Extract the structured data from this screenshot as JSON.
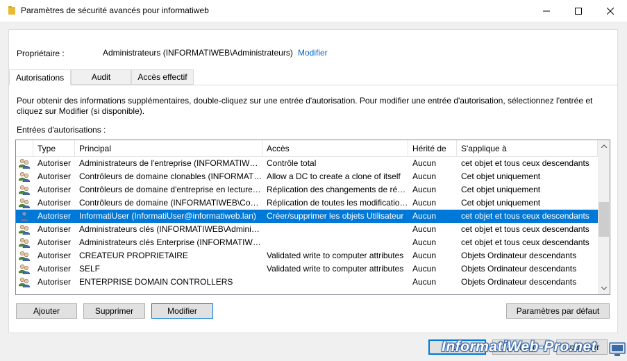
{
  "window": {
    "title": "Paramètres de sécurité avancés pour informatiweb",
    "minimize_glyph": "—",
    "maximize_glyph": "☐",
    "close_glyph": "✕",
    "folder_icon": "folder-icon",
    "folder_color": "#e8b931"
  },
  "owner": {
    "label": "Propriétaire :",
    "value": "Administrateurs (INFORMATIWEB\\Administrateurs)",
    "link": "Modifier",
    "link_color": "#0066cc"
  },
  "tabs": [
    {
      "label": "Autorisations",
      "active": true
    },
    {
      "label": "Audit",
      "active": false
    },
    {
      "label": "Accès effectif",
      "active": false
    }
  ],
  "info_text": "Pour obtenir des informations supplémentaires, double-cliquez sur une entrée d'autorisation. Pour modifier une entrée d'autorisation, sélectionnez l'entrée et cliquez sur Modifier (si disponible).",
  "entries_label": "Entrées d'autorisations :",
  "table": {
    "columns": [
      "Type",
      "Principal",
      "Accès",
      "Hérité de",
      "S'applique à"
    ],
    "rows": [
      {
        "icon": "group-users-icon",
        "type": "Autoriser",
        "principal": "Administrateurs de l'entreprise (INFORMATIWEB\\Administrateurs de l'entreprise)",
        "acces": "Contrôle total",
        "herite": "Aucun",
        "applique": "cet objet et tous ceux descendants",
        "selected": false
      },
      {
        "icon": "group-users-icon",
        "type": "Autoriser",
        "principal": "Contrôleurs de domaine clonables (INFORMATIWEB\\Contrôleurs de domaine clonables)",
        "acces": "Allow a DC to create a clone of itself",
        "herite": "Aucun",
        "applique": "Cet objet uniquement",
        "selected": false
      },
      {
        "icon": "group-users-icon",
        "type": "Autoriser",
        "principal": "Contrôleurs de domaine d'entreprise en lecture seule",
        "acces": "Réplication des changements de répertoire",
        "herite": "Aucun",
        "applique": "Cet objet uniquement",
        "selected": false
      },
      {
        "icon": "group-users-icon",
        "type": "Autoriser",
        "principal": "Contrôleurs de domaine (INFORMATIWEB\\Contrôleurs de domaine)",
        "acces": "Réplication de toutes les modifications",
        "herite": "Aucun",
        "applique": "Cet objet uniquement",
        "selected": false
      },
      {
        "icon": "single-user-icon",
        "type": "Autoriser",
        "principal": "InformatiUser (InformatiUser@informatiweb.lan)",
        "acces": "Créer/supprimer les objets Utilisateur",
        "herite": "Aucun",
        "applique": "cet objet et tous ceux descendants",
        "selected": true
      },
      {
        "icon": "group-users-icon",
        "type": "Autoriser",
        "principal": "Administrateurs clés (INFORMATIWEB\\Administrateurs clés)",
        "acces": "",
        "herite": "Aucun",
        "applique": "cet objet et tous ceux descendants",
        "selected": false
      },
      {
        "icon": "group-users-icon",
        "type": "Autoriser",
        "principal": "Administrateurs clés Enterprise (INFORMATIWEB\\Administrateurs clés Enterprise)",
        "acces": "",
        "herite": "Aucun",
        "applique": "cet objet et tous ceux descendants",
        "selected": false
      },
      {
        "icon": "group-users-icon",
        "type": "Autoriser",
        "principal": "CREATEUR PROPRIETAIRE",
        "acces": "Validated write to computer attributes",
        "herite": "Aucun",
        "applique": "Objets Ordinateur descendants",
        "selected": false
      },
      {
        "icon": "group-users-icon",
        "type": "Autoriser",
        "principal": "SELF",
        "acces": "Validated write to computer attributes",
        "herite": "Aucun",
        "applique": "Objets Ordinateur descendants",
        "selected": false
      },
      {
        "icon": "group-users-icon",
        "type": "Autoriser",
        "principal": "ENTERPRISE DOMAIN CONTROLLERS",
        "acces": "",
        "herite": "Aucun",
        "applique": "Objets Ordinateur descendants",
        "selected": false
      }
    ],
    "selection_color": "#0078d7"
  },
  "buttons": {
    "add": "Ajouter",
    "remove": "Supprimer",
    "edit": "Modifier",
    "defaults": "Paramètres par défaut"
  },
  "dialog_buttons": {
    "ok": "OK",
    "cancel": "Annuler",
    "apply": "Appliquer"
  },
  "watermark": {
    "text": "InformatiWeb-Pro.net"
  }
}
